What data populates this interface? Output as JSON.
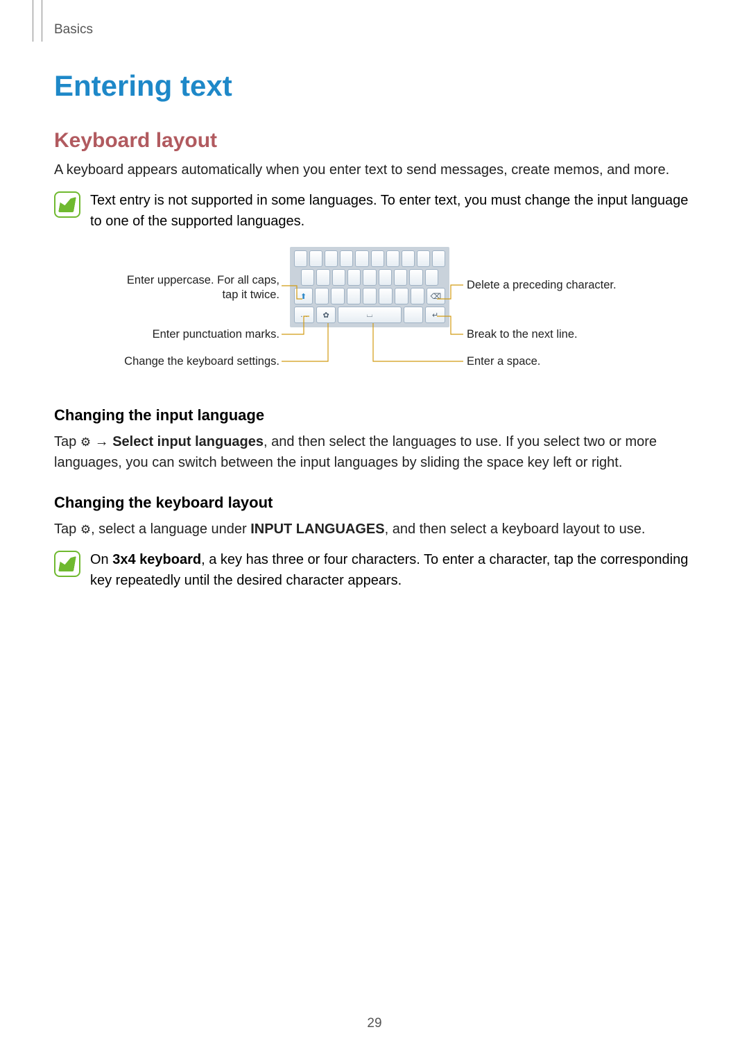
{
  "running_head": "Basics",
  "title": "Entering text",
  "section_keyboard_layout": {
    "heading": "Keyboard layout",
    "intro": "A keyboard appears automatically when you enter text to send messages, create memos, and more.",
    "note": "Text entry is not supported in some languages. To enter text, you must change the input language to one of the supported languages."
  },
  "diagram": {
    "left": {
      "uppercase": "Enter uppercase. For all caps, tap it twice.",
      "punctuation": "Enter punctuation marks.",
      "settings": "Change the keyboard settings."
    },
    "right": {
      "delete": "Delete a preceding character.",
      "newline": "Break to the next line.",
      "space": "Enter a space."
    },
    "keys": {
      "shift_glyph": "⬆",
      "backspace_glyph": "⌫",
      "settings_glyph": "✿",
      "space_glyph": "⌴",
      "enter_glyph": "↵",
      "dots_glyph": "…"
    }
  },
  "section_input_lang": {
    "heading": "Changing the input language",
    "p_pre": "Tap ",
    "arrow": " → ",
    "bold": "Select input languages",
    "p_post": ", and then select the languages to use. If you select two or more languages, you can switch between the input languages by sliding the space key left or right."
  },
  "section_kb_layout": {
    "heading": "Changing the keyboard layout",
    "p_pre": "Tap ",
    "p_mid": ", select a language under ",
    "bold": "INPUT LANGUAGES",
    "p_post": ", and then select a keyboard layout to use."
  },
  "note_3x4": {
    "pre": "On ",
    "bold": "3x4 keyboard",
    "post": ", a key has three or four characters. To enter a character, tap the corresponding key repeatedly until the desired character appears."
  },
  "page_number": "29"
}
